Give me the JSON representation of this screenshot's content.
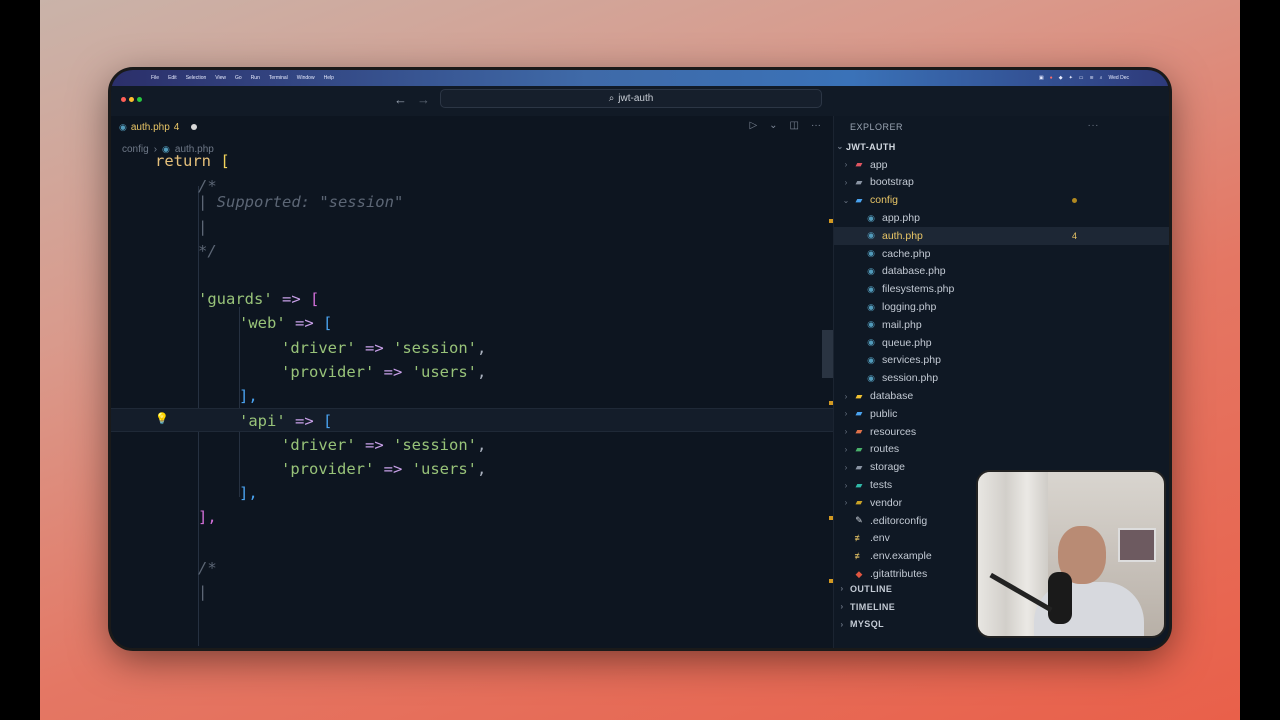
{
  "menubar": {
    "items": [
      "File",
      "Edit",
      "Selection",
      "View",
      "Go",
      "Run",
      "Terminal",
      "Window",
      "Help"
    ],
    "clock": "Wed Dec"
  },
  "titlebar": {
    "search_icon": "search-icon",
    "title": "jwt-auth"
  },
  "tab": {
    "filename": "auth.php",
    "problems": "4"
  },
  "breadcrumb": {
    "folder": "config",
    "file": "auth.php"
  },
  "code": {
    "l_return": "return",
    "l_open_bracket": "[",
    "l_comment_open": "/*",
    "l_supported": "| Supported: \"session\"",
    "l_bar": "|",
    "l_comment_close": "*/",
    "guards_key": "'guards'",
    "arrow": "=>",
    "web_key": "'web'",
    "driver_key": "'driver'",
    "session_val": "'session'",
    "provider_key": "'provider'",
    "users_val": "'users'",
    "close_bracket": "],",
    "api_key": "'api'",
    "close_guards": "],",
    "l_comment_open2": "/*",
    "l_bar2": "|"
  },
  "explorer": {
    "title": "EXPLORER",
    "root": "JWT-AUTH",
    "items": [
      {
        "label": "app",
        "kind": "folder",
        "icon_color": "#e05561"
      },
      {
        "label": "bootstrap",
        "kind": "folder",
        "icon_color": "#8a94a3"
      },
      {
        "label": "config",
        "kind": "folder-open",
        "icon_color": "#4aa3f0"
      },
      {
        "label": "app.php",
        "kind": "php"
      },
      {
        "label": "auth.php",
        "kind": "php",
        "badge": "4"
      },
      {
        "label": "cache.php",
        "kind": "php"
      },
      {
        "label": "database.php",
        "kind": "php"
      },
      {
        "label": "filesystems.php",
        "kind": "php"
      },
      {
        "label": "logging.php",
        "kind": "php"
      },
      {
        "label": "mail.php",
        "kind": "php"
      },
      {
        "label": "queue.php",
        "kind": "php"
      },
      {
        "label": "services.php",
        "kind": "php"
      },
      {
        "label": "session.php",
        "kind": "php"
      },
      {
        "label": "database",
        "kind": "folder",
        "icon_color": "#f1c232"
      },
      {
        "label": "public",
        "kind": "folder",
        "icon_color": "#4aa3f0"
      },
      {
        "label": "resources",
        "kind": "folder",
        "icon_color": "#e0724a"
      },
      {
        "label": "routes",
        "kind": "folder",
        "icon_color": "#49b16b"
      },
      {
        "label": "storage",
        "kind": "folder",
        "icon_color": "#8a94a3"
      },
      {
        "label": "tests",
        "kind": "folder",
        "icon_color": "#30b9a8"
      },
      {
        "label": "vendor",
        "kind": "folder",
        "icon_color": "#c9a227"
      },
      {
        "label": ".editorconfig",
        "kind": "file"
      },
      {
        "label": ".env",
        "kind": "env"
      },
      {
        "label": ".env.example",
        "kind": "env"
      },
      {
        "label": ".gitattributes",
        "kind": "git"
      }
    ],
    "panels": [
      "OUTLINE",
      "TIMELINE",
      "MYSQL"
    ]
  }
}
